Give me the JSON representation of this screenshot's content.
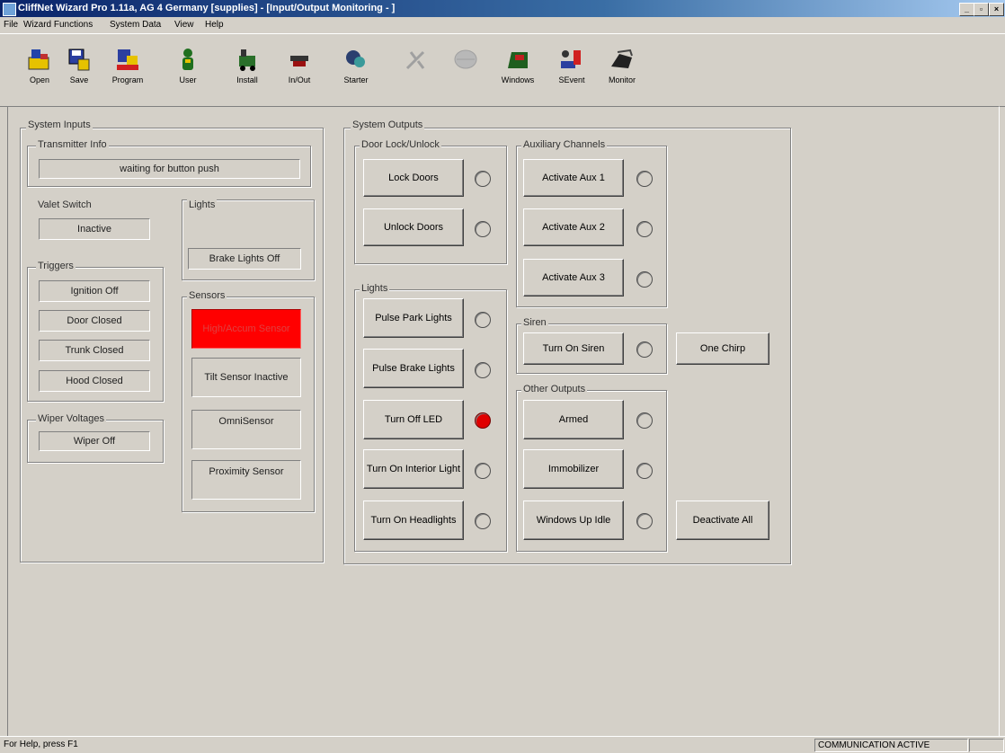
{
  "window": {
    "title": "CliffNet Wizard Pro 1.11a, AG 4 Germany [supplies] - [Input/Output Monitoring - ]",
    "minimize": "_",
    "restore": "▫",
    "close": "×"
  },
  "menu": [
    "File",
    "Wizard Functions",
    "System Data",
    "View",
    "Help"
  ],
  "toolbar": [
    {
      "label": "Open",
      "icon": "open-icon",
      "enabled": true
    },
    {
      "label": "Save",
      "icon": "save-icon",
      "enabled": true
    },
    {
      "label": "Program",
      "icon": "program-icon",
      "enabled": true
    },
    {
      "label": "User",
      "icon": "user-icon",
      "enabled": true
    },
    {
      "label": "Install",
      "icon": "install-icon",
      "enabled": true
    },
    {
      "label": "In/Out",
      "icon": "in-out-icon",
      "enabled": true
    },
    {
      "label": "Starter",
      "icon": "starter-icon",
      "enabled": true
    },
    {
      "label": "",
      "icon": "disabled-tool-icon",
      "enabled": false
    },
    {
      "label": "",
      "icon": "disabled-tool-icon",
      "enabled": false
    },
    {
      "label": "Windows",
      "icon": "windows-icon",
      "enabled": true
    },
    {
      "label": "SEvent",
      "icon": "sevent-icon",
      "enabled": true
    },
    {
      "label": "Monitor",
      "icon": "monitor-icon",
      "enabled": true
    }
  ],
  "inputs": {
    "title": "System Inputs",
    "transmitter": {
      "title": "Transmitter Info",
      "value": "waiting for button push"
    },
    "valet": {
      "title": "Valet Switch",
      "value": "Inactive"
    },
    "lights": {
      "title": "Lights",
      "value": "Brake Lights Off"
    },
    "triggers": {
      "title": "Triggers",
      "items": [
        "Ignition Off",
        "Door Closed",
        "Trunk Closed",
        "Hood Closed"
      ]
    },
    "sensors": {
      "title": "Sensors",
      "items": [
        "High/Accum Sensor",
        "Tilt Sensor Inactive",
        "OmniSensor",
        "Proximity Sensor"
      ]
    },
    "wiper": {
      "title": "Wiper Voltages",
      "value": "Wiper Off"
    }
  },
  "outputs": {
    "title": "System Outputs",
    "doorlock": {
      "title": "Door Lock/Unlock",
      "buttons": [
        "Lock Doors",
        "Unlock Doors"
      ]
    },
    "lights": {
      "title": "Lights",
      "buttons": [
        "Pulse Park Lights",
        "Pulse Brake Lights",
        "Turn Off LED",
        "Turn On Interior Light",
        "Turn On Headlights"
      ]
    },
    "aux": {
      "title": "Auxiliary Channels",
      "buttons": [
        "Activate Aux 1",
        "Activate Aux 2",
        "Activate Aux 3"
      ]
    },
    "siren": {
      "title": "Siren",
      "button": "Turn On Siren",
      "chirp": "One Chirp"
    },
    "other": {
      "title": "Other Outputs",
      "buttons": [
        "Armed",
        "Immobilizer",
        "Windows Up Idle"
      ],
      "deactivate": "Deactivate All"
    }
  },
  "status": {
    "help": "For Help, press F1",
    "comm": "COMMUNICATION ACTIVE"
  },
  "colors": {
    "sensor_alert": "#ff0000",
    "led_on": "#e00000"
  }
}
